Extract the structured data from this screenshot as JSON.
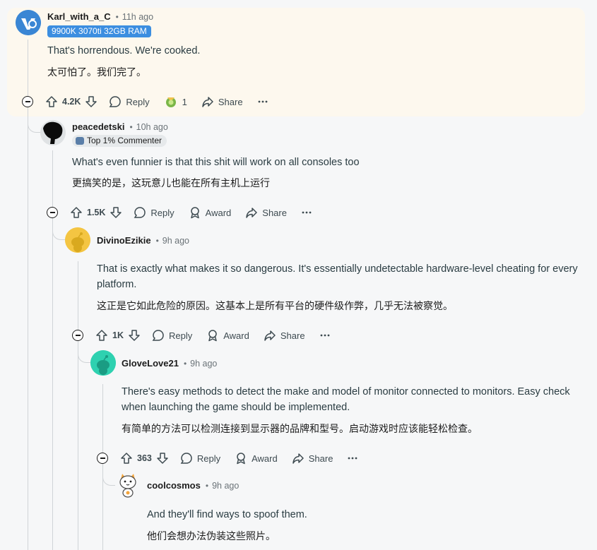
{
  "comments": [
    {
      "username": "Karl_with_a_C",
      "time": "11h ago",
      "flair": "9900K 3070ti 32GB RAM",
      "text_en": "That's horrendous. We're cooked.",
      "text_zh": "太可怕了。我们完了。",
      "votes": "4.2K",
      "reply_label": "Reply",
      "award_count": "1",
      "share_label": "Share",
      "avatar_icon": "reddit-bubble-avatar-icon"
    },
    {
      "username": "peacedetski",
      "time": "10h ago",
      "flair": "Top 1% Commenter",
      "text_en": "What's even funnier is that this shit will work on all consoles too",
      "text_zh": "更搞笑的是，这玩意儿也能在所有主机上运行",
      "votes": "1.5K",
      "reply_label": "Reply",
      "award_label": "Award",
      "share_label": "Share",
      "avatar_icon": "black-blob-avatar-icon"
    },
    {
      "username": "DivinoEzikie",
      "time": "9h ago",
      "text_en": "That is exactly what makes it so dangerous. It's essentially undetectable hardware-level cheating for every platform.",
      "text_zh": "这正是它如此危险的原因。这基本上是所有平台的硬件级作弊，几乎无法被察觉。",
      "votes": "1K",
      "reply_label": "Reply",
      "award_label": "Award",
      "share_label": "Share",
      "avatar_icon": "snoo-yellow-avatar-icon"
    },
    {
      "username": "GloveLove21",
      "time": "9h ago",
      "text_en": "There's easy methods to detect the make and model of monitor connected to monitors. Easy check when launching the game should be implemented.",
      "text_zh": "有简单的方法可以检测连接到显示器的品牌和型号。启动游戏时应该能轻松检查。",
      "votes": "363",
      "reply_label": "Reply",
      "award_label": "Award",
      "share_label": "Share",
      "avatar_icon": "snoo-teal-avatar-icon"
    },
    {
      "username": "coolcosmos",
      "time": "9h ago",
      "text_en": "And they'll find ways to spoof them.",
      "text_zh": "他们会想办法伪装这些照片。",
      "avatar_icon": "snoo-cat-avatar-icon"
    }
  ],
  "colors": {
    "highlight_bg": "#fdf8ee",
    "flair_blue": "#3c8ee0",
    "thread_line": "#d0d4d7",
    "page_bg": "#f6f7f8"
  },
  "meta_separator": "•"
}
